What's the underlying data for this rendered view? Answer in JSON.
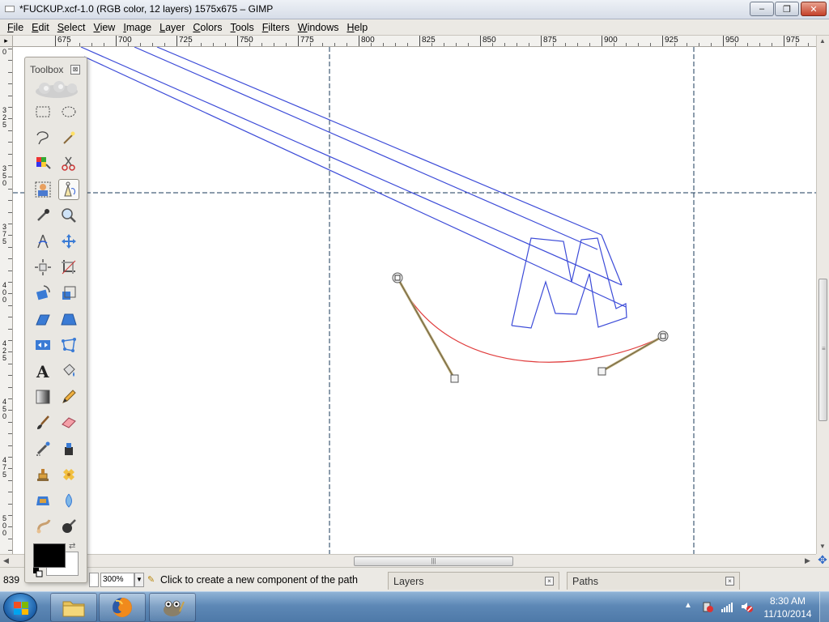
{
  "window": {
    "title": "*FUCKUP.xcf-1.0 (RGB color, 12 layers) 1575x675 – GIMP",
    "min_glyph": "–",
    "max_glyph": "❐",
    "close_glyph": "✕"
  },
  "menu": [
    "File",
    "Edit",
    "Select",
    "View",
    "Image",
    "Layer",
    "Colors",
    "Tools",
    "Filters",
    "Windows",
    "Help"
  ],
  "ruler": {
    "corner_glyph": "▸",
    "h_labels": [
      "675",
      "700",
      "725",
      "750",
      "775",
      "800",
      "825",
      "850",
      "875",
      "900",
      "925",
      "950",
      "975"
    ],
    "v_labels": [
      "0",
      "325",
      "350",
      "375",
      "400",
      "425",
      "450",
      "475",
      "500"
    ]
  },
  "toolbox": {
    "title": "Toolbox",
    "close_glyph": "⊠",
    "swap_glyph": "⇄",
    "tools": [
      "rect-select",
      "ellipse-select",
      "free-select",
      "fuzzy-select",
      "select-by-color",
      "scissors-select",
      "foreground-select",
      "paths",
      "color-picker",
      "zoom",
      "measure",
      "move",
      "align",
      "crop",
      "rotate",
      "scale",
      "shear",
      "perspective",
      "flip",
      "cage-transform",
      "text",
      "bucket-fill",
      "blend",
      "pencil",
      "paintbrush",
      "eraser",
      "airbrush",
      "ink",
      "clone",
      "heal",
      "perspective-clone",
      "blur-sharpen",
      "smudge",
      "dodge-burn"
    ],
    "active_tool": "paths",
    "fg_color": "#000000",
    "bg_color": "#ffffff"
  },
  "canvas": {
    "guide_color": "#1a3a5a",
    "path_color": "#3c4bd8",
    "curve_color": "#e03c3c",
    "handle_color": "#b8a878"
  },
  "status": {
    "coords": "839",
    "zoom": "300%",
    "message": "Click to create a new component of the path"
  },
  "dock_tabs": [
    "Layers",
    "Paths"
  ],
  "taskbar": {
    "apps": [
      "explorer",
      "firefox",
      "gimp"
    ],
    "time": "8:30 AM",
    "date": "11/10/2014",
    "tray_chevron": "▲"
  }
}
